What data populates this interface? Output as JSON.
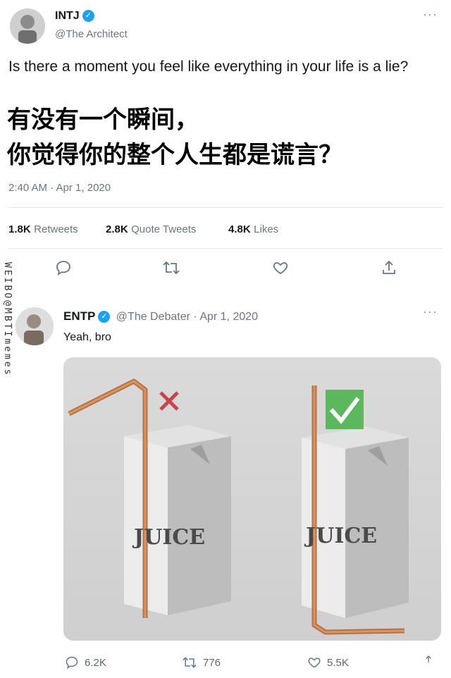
{
  "tweet": {
    "name": "INTJ",
    "handle": "@The Architect",
    "text_en": "Is there a moment you feel like everything in your life is a lie?",
    "text_cn_line1": "有没有一个瞬间，",
    "text_cn_line2": "你觉得你的整个人生都是谎言？",
    "timestamp": "2:40 AM · Apr 1, 2020",
    "stats": {
      "retweets_num": "1.8K",
      "retweets_label": "Retweets",
      "quotes_num": "2.8K",
      "quotes_label": "Quote Tweets",
      "likes_num": "4.8K",
      "likes_label": "Likes"
    },
    "more": "···"
  },
  "reply": {
    "name": "ENTP",
    "handle_date": "@The Debater · Apr 1, 2020",
    "text": "Yeah, bro",
    "more": "···",
    "image": {
      "left_label": "JUICE",
      "right_label": "JUICE"
    },
    "counts": {
      "replies": "6.2K",
      "retweets": "776",
      "likes": "5.5K"
    }
  },
  "watermark": "WEIBO@MBTImemes",
  "colors": {
    "accent": "#1da1f2",
    "text": "#14171a",
    "muted": "#6b7680",
    "check_green": "#5cb85c",
    "cross_red": "#c9434c"
  },
  "icons": [
    "reply-icon",
    "retweet-icon",
    "like-icon",
    "share-icon",
    "verified-icon"
  ]
}
